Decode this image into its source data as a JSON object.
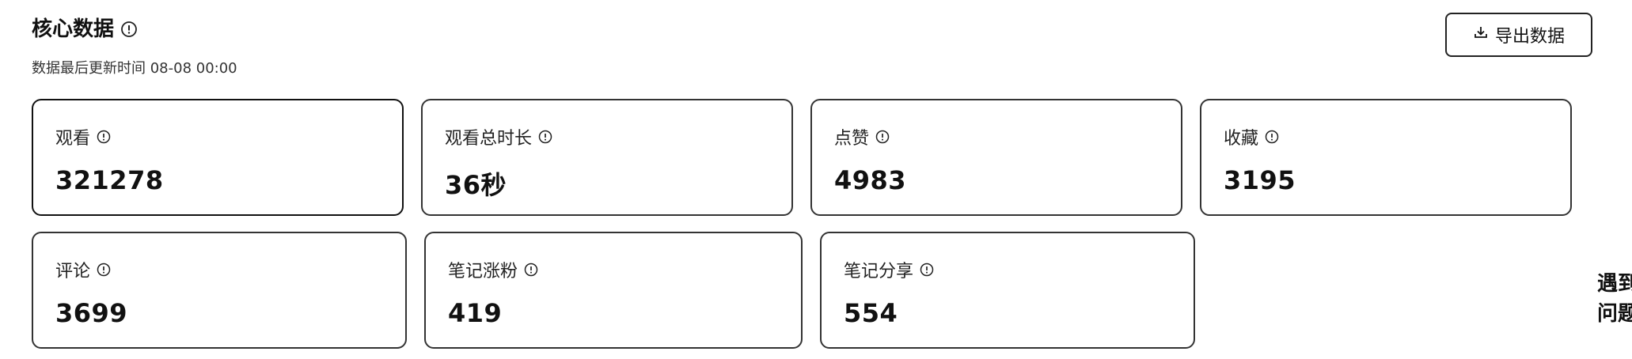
{
  "header": {
    "title": "核心数据",
    "subtitle": "数据最后更新时间 08-08 00:00"
  },
  "toolbar": {
    "export_label": "导出数据"
  },
  "metrics": [
    {
      "label": "观看",
      "value": "321278"
    },
    {
      "label": "观看总时长",
      "value": "36秒"
    },
    {
      "label": "点赞",
      "value": "4983"
    },
    {
      "label": "收藏",
      "value": "3195"
    },
    {
      "label": "评论",
      "value": "3699"
    },
    {
      "label": "笔记涨粉",
      "value": "419"
    },
    {
      "label": "笔记分享",
      "value": "554"
    }
  ],
  "help": {
    "line1": "遇到",
    "line2": "问题"
  },
  "icons": {
    "info": "info-circle-icon",
    "export": "download-icon"
  }
}
